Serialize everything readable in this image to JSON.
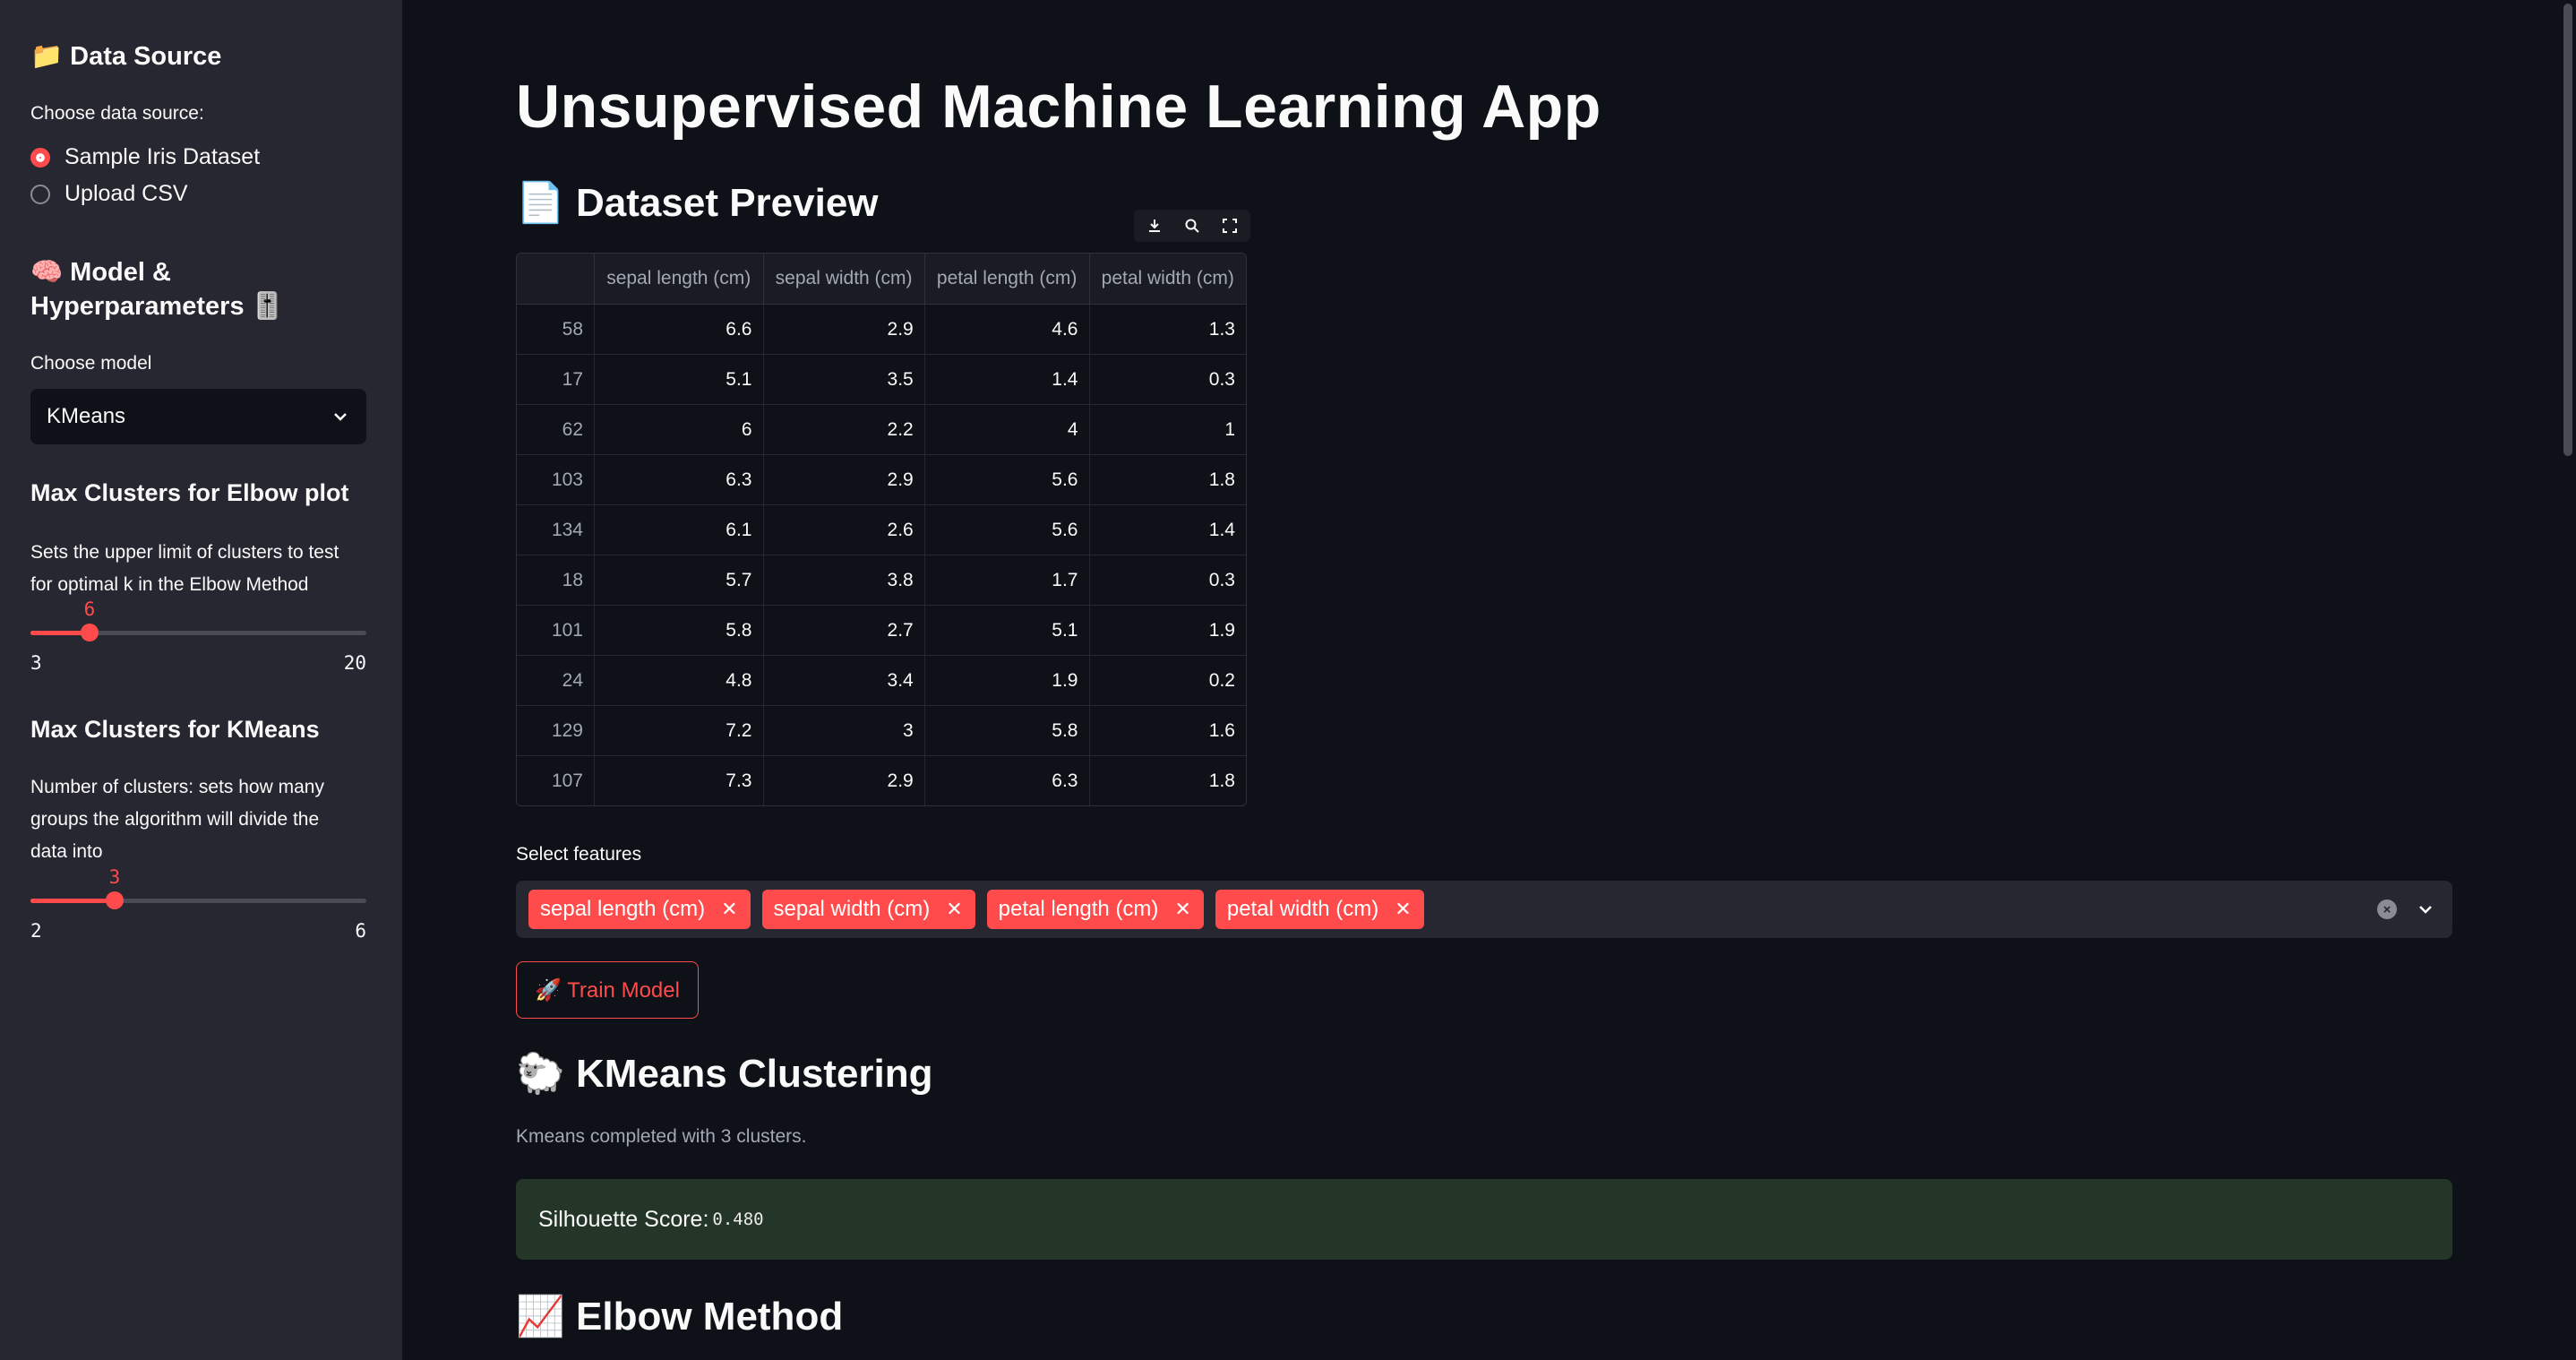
{
  "sidebar": {
    "data_source": {
      "heading": "📁 Data Source",
      "label": "Choose data source:",
      "options": [
        "Sample Iris Dataset",
        "Upload CSV"
      ],
      "selected": "Sample Iris Dataset"
    },
    "model": {
      "heading_line1": "🧠 Model &",
      "heading_line2": "Hyperparameters 🎚️",
      "label": "Choose model",
      "selected": "KMeans"
    },
    "elbow_slider": {
      "title": "Max Clusters for Elbow plot",
      "help_line1": "Sets the upper limit of clusters to test",
      "help_line2": "for optimal k in the Elbow Method",
      "value": "6",
      "min": "3",
      "max": "20",
      "fraction": 0.176
    },
    "kmeans_slider": {
      "title": "Max Clusters for KMeans",
      "help_line1": "Number of clusters: sets how many",
      "help_line2": "groups the algorithm will divide the",
      "help_line3": "data into",
      "value": "3",
      "min": "2",
      "max": "6",
      "fraction": 0.25
    }
  },
  "main": {
    "title": "Unsupervised Machine Learning App",
    "preview_heading": "📄 Dataset Preview",
    "toolbar": {
      "download": "download-icon",
      "search": "search-icon",
      "fullscreen": "fullscreen-icon"
    },
    "table": {
      "columns": [
        "",
        "sepal length (cm)",
        "sepal width (cm)",
        "petal length (cm)",
        "petal width (cm)"
      ],
      "rows": [
        [
          "58",
          "6.6",
          "2.9",
          "4.6",
          "1.3"
        ],
        [
          "17",
          "5.1",
          "3.5",
          "1.4",
          "0.3"
        ],
        [
          "62",
          "6",
          "2.2",
          "4",
          "1"
        ],
        [
          "103",
          "6.3",
          "2.9",
          "5.6",
          "1.8"
        ],
        [
          "134",
          "6.1",
          "2.6",
          "5.6",
          "1.4"
        ],
        [
          "18",
          "5.7",
          "3.8",
          "1.7",
          "0.3"
        ],
        [
          "101",
          "5.8",
          "2.7",
          "5.1",
          "1.9"
        ],
        [
          "24",
          "4.8",
          "3.4",
          "1.9",
          "0.2"
        ],
        [
          "129",
          "7.2",
          "3",
          "5.8",
          "1.6"
        ],
        [
          "107",
          "7.3",
          "2.9",
          "6.3",
          "1.8"
        ]
      ]
    },
    "features": {
      "label": "Select features",
      "tags": [
        "sepal length (cm)",
        "sepal width (cm)",
        "petal length (cm)",
        "petal width (cm)"
      ]
    },
    "train_button": "🚀 Train Model",
    "clustering_heading": "🐑 KMeans Clustering",
    "clustering_caption": "Kmeans completed with 3 clusters.",
    "silhouette_label": "Silhouette Score:",
    "silhouette_value": "0.480",
    "elbow_heading": "📈 Elbow Method"
  },
  "colors": {
    "accent": "#ff4b4b",
    "background": "#0e1117",
    "sidebar": "#262730",
    "success_bg": "#243628"
  }
}
